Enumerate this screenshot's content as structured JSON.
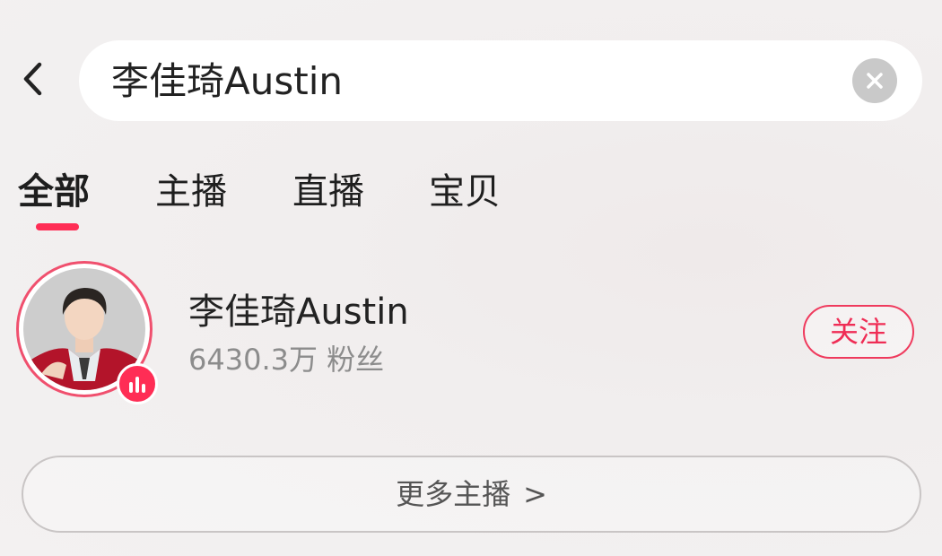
{
  "header": {
    "back_icon": "chevron-left-icon",
    "search": {
      "value": "李佳琦Austin",
      "clear_icon": "clear-x-icon"
    }
  },
  "tabs": [
    {
      "label": "全部",
      "active": true
    },
    {
      "label": "主播",
      "active": false
    },
    {
      "label": "直播",
      "active": false
    },
    {
      "label": "宝贝",
      "active": false
    }
  ],
  "result": {
    "name": "李佳琦Austin",
    "fans": "6430.3万 粉丝",
    "follow_label": "关注",
    "live_icon": "live-bars-icon"
  },
  "more_anchors": {
    "label": "更多主播",
    "arrow": ">"
  },
  "colors": {
    "accent": "#ff2d55",
    "follow": "#ef2d55",
    "background": "#f2efef"
  }
}
